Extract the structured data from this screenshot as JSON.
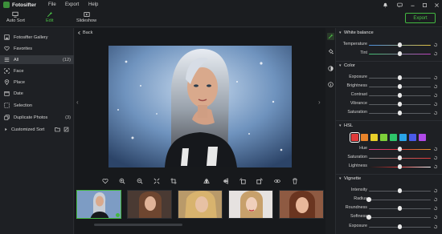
{
  "app": {
    "name": "Fotosifter",
    "menu": [
      {
        "key": "file",
        "label": "File"
      },
      {
        "key": "export",
        "label": "Export"
      },
      {
        "key": "help",
        "label": "Help"
      }
    ]
  },
  "window_controls": [
    "bell-icon",
    "chat-icon",
    "minimize-icon",
    "maximize-icon",
    "close-icon"
  ],
  "toolbar": {
    "tools": [
      {
        "key": "auto-sort",
        "label": "Auto Sort",
        "icon": "monitor-icon",
        "active": false
      },
      {
        "key": "edit",
        "label": "Edit",
        "icon": "magic-wand-icon",
        "active": true
      },
      {
        "key": "slideshow",
        "label": "Slideshow",
        "icon": "slideshow-icon",
        "active": false
      }
    ],
    "export_label": "Export"
  },
  "sidebar": {
    "items": [
      {
        "key": "gallery",
        "label": "Fotosifter Gallery",
        "count": "",
        "icon": "gallery-icon",
        "active": false
      },
      {
        "key": "favorites",
        "label": "Favorites",
        "count": "",
        "icon": "heart-icon",
        "active": false
      },
      {
        "key": "all",
        "label": "All",
        "count": "(12)",
        "icon": "list-icon",
        "active": true
      },
      {
        "key": "face",
        "label": "Face",
        "count": "",
        "icon": "face-icon",
        "active": false
      },
      {
        "key": "place",
        "label": "Place",
        "count": "",
        "icon": "pin-icon",
        "active": false
      },
      {
        "key": "date",
        "label": "Date",
        "count": "",
        "icon": "calendar-icon",
        "active": false
      },
      {
        "key": "selection",
        "label": "Selection",
        "count": "",
        "icon": "selection-icon",
        "active": false
      },
      {
        "key": "duplicate",
        "label": "Duplicate Photos",
        "count": "(3)",
        "icon": "duplicate-icon",
        "active": false
      },
      {
        "key": "custom",
        "label": "Customized Sort",
        "count": "",
        "icon": "caret-right-icon",
        "active": false
      }
    ]
  },
  "main": {
    "back_label": "Back",
    "image_tools": [
      "heart-icon",
      "zoom-in-icon",
      "zoom-out-icon",
      "fit-icon",
      "crop-icon",
      "flip-horizontal-icon",
      "flip-vertical-icon",
      "rotate-left-icon",
      "rotate-right-icon",
      "eye-icon",
      "compare-icon",
      "delete-icon"
    ],
    "thumbnails": [
      {
        "key": "thumb-1",
        "selected": true
      },
      {
        "key": "thumb-2",
        "selected": false
      },
      {
        "key": "thumb-3",
        "selected": false
      },
      {
        "key": "thumb-4",
        "selected": false
      },
      {
        "key": "thumb-5",
        "selected": false
      }
    ]
  },
  "right_tabs": [
    "adjust-icon",
    "bucket-icon",
    "filter-icon",
    "info-icon"
  ],
  "panel": {
    "white_balance": {
      "title": "White balance",
      "sliders": [
        {
          "key": "temperature",
          "label": "Temperature",
          "value": 0.5,
          "track": "#e0c040"
        },
        {
          "key": "tint",
          "label": "Tint",
          "value": 0.5,
          "track": "#c040c0"
        }
      ]
    },
    "color": {
      "title": "Color",
      "sliders": [
        {
          "key": "exposure",
          "label": "Exposure",
          "value": 0.5
        },
        {
          "key": "brightness",
          "label": "Brightness",
          "value": 0.5
        },
        {
          "key": "contrast",
          "label": "Contrast",
          "value": 0.5
        },
        {
          "key": "vibrance",
          "label": "Vibrance",
          "value": 0.5
        },
        {
          "key": "saturation",
          "label": "Saturation",
          "value": 0.5
        }
      ]
    },
    "hsl": {
      "title": "HSL",
      "swatches": [
        "#e03a3a",
        "#e8832a",
        "#e8d02a",
        "#7ed03a",
        "#2ec46a",
        "#2aa4e8",
        "#4a5ae8",
        "#b04ae8"
      ],
      "selected_swatch": 0,
      "sliders": [
        {
          "key": "hue",
          "label": "Hue",
          "value": 0.5
        },
        {
          "key": "hsl-saturation",
          "label": "Saturation",
          "value": 0.5
        },
        {
          "key": "lightness",
          "label": "Lightness",
          "value": 0.5
        }
      ]
    },
    "vignette": {
      "title": "Vignette",
      "sliders": [
        {
          "key": "intensity",
          "label": "Intensity",
          "value": 0.5
        },
        {
          "key": "radius",
          "label": "Radius",
          "value": 0.0
        },
        {
          "key": "roundness",
          "label": "Roundness",
          "value": 0.5
        },
        {
          "key": "softness",
          "label": "Softness",
          "value": 0.0
        },
        {
          "key": "vig-exposure",
          "label": "Exposure",
          "value": 0.5
        }
      ]
    }
  },
  "colors": {
    "accent": "#43b841",
    "background": "#1b1d20",
    "panel": "#1e2024"
  }
}
